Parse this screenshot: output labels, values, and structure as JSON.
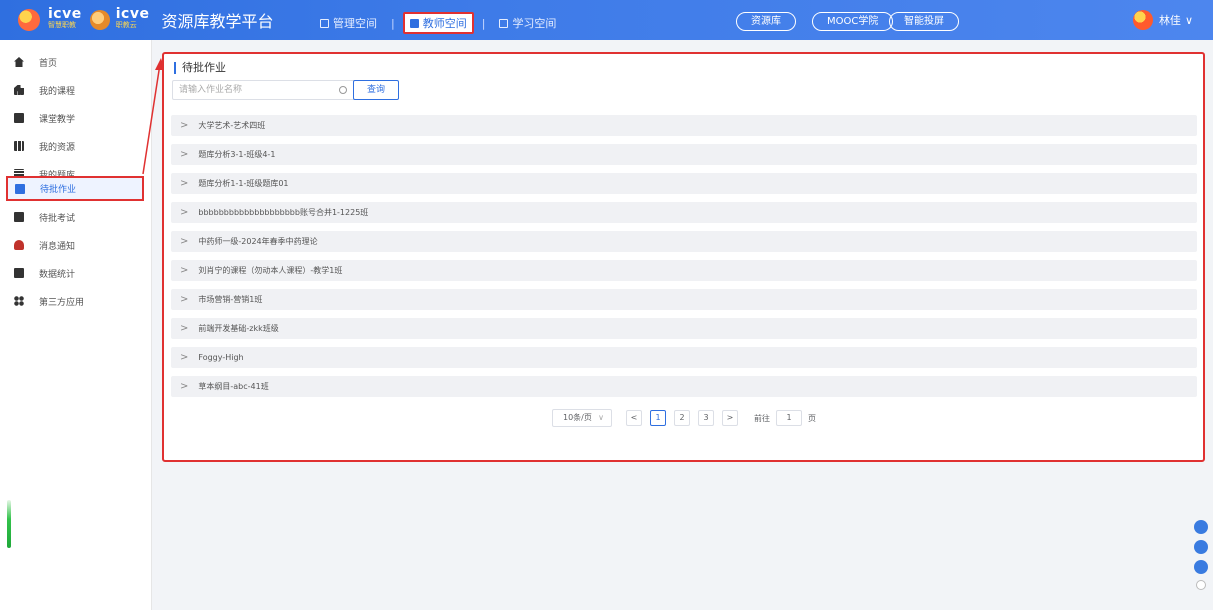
{
  "header": {
    "logo_primary": "icve",
    "logo_primary_sub": "智慧职教",
    "logo_secondary": "icve",
    "logo_secondary_sub": "职教云",
    "title": "资源库教学平台",
    "nav": [
      {
        "label": "管理空间",
        "active": false
      },
      {
        "label": "教师空间",
        "active": true
      },
      {
        "label": "学习空间",
        "active": false
      }
    ],
    "separator": "|",
    "pills": [
      "资源库",
      "MOOC学院",
      "智能投屏"
    ],
    "user_name": "林佳",
    "user_caret": "∨",
    "accent_color": "#2f6fe0"
  },
  "sidebar": {
    "items": [
      {
        "label": "首页",
        "icon": "home-icon",
        "active": false
      },
      {
        "label": "我的课程",
        "icon": "course-icon",
        "active": false
      },
      {
        "label": "课堂教学",
        "icon": "classroom-icon",
        "active": false
      },
      {
        "label": "我的资源",
        "icon": "resource-icon",
        "active": false
      },
      {
        "label": "我的题库",
        "icon": "question-bank-icon",
        "active": false
      },
      {
        "label": "待批作业",
        "icon": "homework-icon",
        "active": true
      },
      {
        "label": "待批考试",
        "icon": "exam-icon",
        "active": false
      },
      {
        "label": "消息通知",
        "icon": "notification-icon",
        "active": false
      },
      {
        "label": "数据统计",
        "icon": "statistics-icon",
        "active": false
      },
      {
        "label": "第三方应用",
        "icon": "third-party-app-icon",
        "active": false
      }
    ]
  },
  "main": {
    "title": "待批作业",
    "search_placeholder": "请输入作业名称",
    "query_label": "查询",
    "rows": [
      "大学艺术-艺术四班",
      "题库分析3-1-班级4-1",
      "题库分析1-1-班级题库01",
      "bbbbbbbbbbbbbbbbbbbb账号合并1-1225班",
      "中药师一级-2024年春季中药理论",
      "刘肖宁的课程（勿动本人课程）-教学1班",
      "市场营销-营销1班",
      "前端开发基础-zkk班级",
      "Foggy-High",
      "草本纲目-abc-41班"
    ],
    "row_chevron": ">",
    "pagination": {
      "page_size": "10条/页",
      "prev": "<",
      "next": ">",
      "pages": [
        "1",
        "2",
        "3"
      ],
      "current_page": "1",
      "goto_label": "前往",
      "goto_value": "1",
      "goto_suffix": "页"
    }
  }
}
